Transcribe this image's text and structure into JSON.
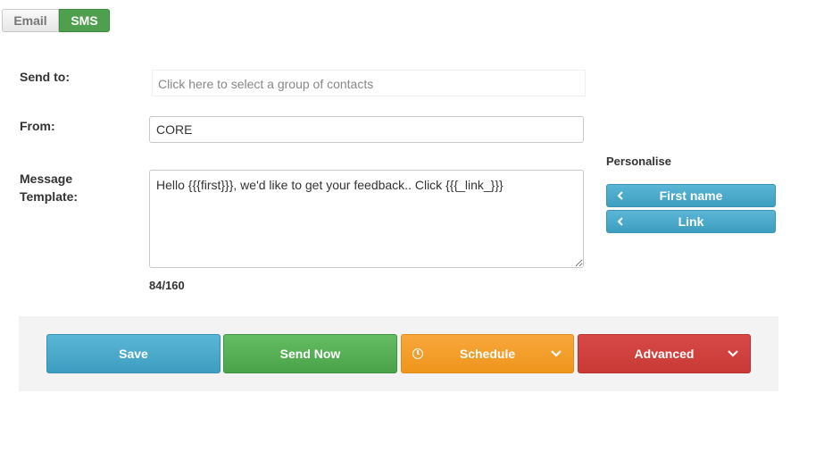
{
  "tabs": {
    "email": "Email",
    "sms": "SMS"
  },
  "form": {
    "send_to": {
      "label": "Send to:",
      "placeholder": "Click here to select a group of contacts"
    },
    "from": {
      "label": "From:",
      "value": "CORE"
    },
    "message": {
      "label": "Message Template:",
      "value": "Hello {{{first}}}, we'd like to get your feedback.. Click {{{_link_}}}"
    },
    "counter": "84/160"
  },
  "personalise": {
    "title": "Personalise",
    "buttons": [
      {
        "label": "First name",
        "icon": "chevron-left-icon"
      },
      {
        "label": "Link",
        "icon": "chevron-left-icon"
      }
    ]
  },
  "actions": {
    "save": "Save",
    "send_now": "Send Now",
    "schedule": "Schedule",
    "advanced": "Advanced"
  },
  "colors": {
    "sms_tab": "#4e9f4e",
    "info": "#3d9ec0",
    "success": "#4aa348",
    "warning": "#ef951c",
    "danger": "#c93a37"
  }
}
